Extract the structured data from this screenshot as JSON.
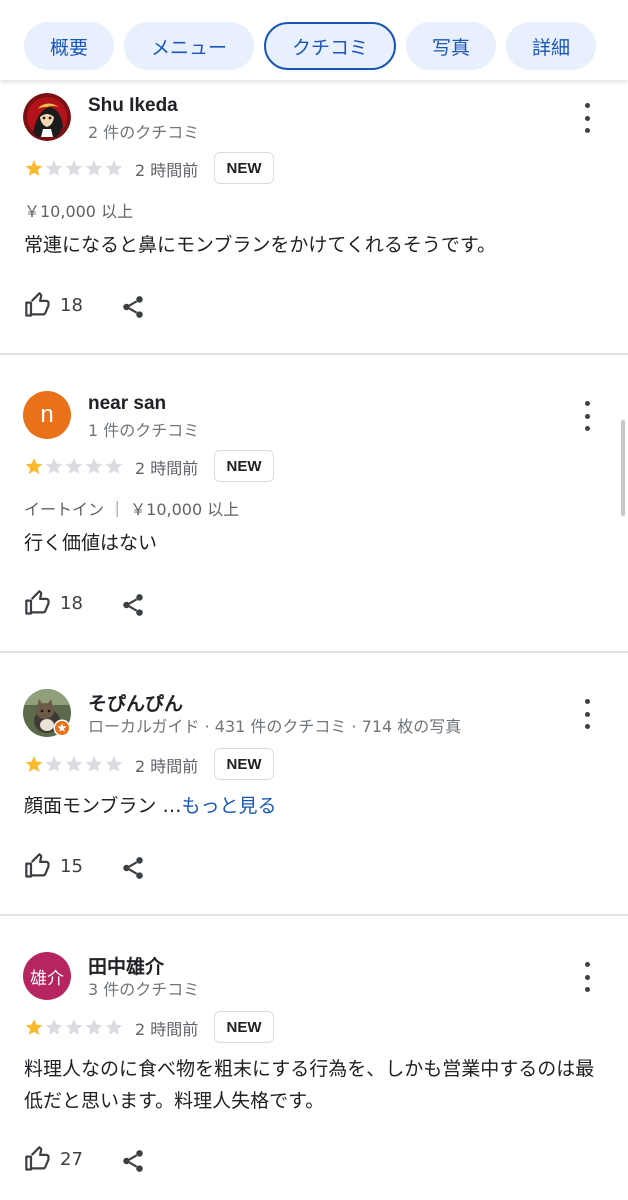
{
  "tabs": [
    {
      "label": "概要"
    },
    {
      "label": "メニュー"
    },
    {
      "label": "クチコミ"
    },
    {
      "label": "写真"
    },
    {
      "label": "詳細"
    }
  ],
  "active_tab": "クチコミ",
  "colors": {
    "accent": "#1a56b8",
    "tab_bg": "#e8f0fe",
    "star_filled": "#f9bb2d",
    "star_empty": "#dadce0"
  },
  "reviews": [
    {
      "name": "Shu Ikeda",
      "meta": "2 件のクチコミ",
      "rating": 1,
      "time": "2 時間前",
      "badge": "NEW",
      "price": "￥10,000 以上",
      "text": "常連になると鼻にモンブランをかけてくれるそうです。",
      "likes": "18",
      "avatar": {
        "type": "photo",
        "icon": "anime-character-avatar"
      }
    },
    {
      "name": "near san",
      "meta": "1 件のクチコミ",
      "rating": 1,
      "time": "2 時間前",
      "badge": "NEW",
      "price": "イートイン ｜ ￥10,000 以上",
      "text": "行く価値はない",
      "likes": "18",
      "avatar": {
        "type": "letter",
        "letter": "n",
        "color": "#e8711a"
      }
    },
    {
      "name": "そぴんぴん",
      "meta": "ローカルガイド · 431 件のクチコミ · 714 枚の写真",
      "rating": 1,
      "time": "2 時間前",
      "badge": "NEW",
      "text": "顔面モンブラン …",
      "more_link": "もっと見る",
      "likes": "15",
      "avatar": {
        "type": "photo",
        "icon": "cat-photo-avatar",
        "badge_icon": "local-guide-badge-icon"
      }
    },
    {
      "name": "田中雄介",
      "meta": "3 件のクチコミ",
      "rating": 1,
      "time": "2 時間前",
      "badge": "NEW",
      "text": "料理人なのに食べ物を粗末にする行為を、しかも営業中するのは最低だと思います。料理人失格です。",
      "likes": "27",
      "avatar": {
        "type": "letter",
        "letter": "雄介",
        "color": "#b6255f"
      }
    }
  ]
}
